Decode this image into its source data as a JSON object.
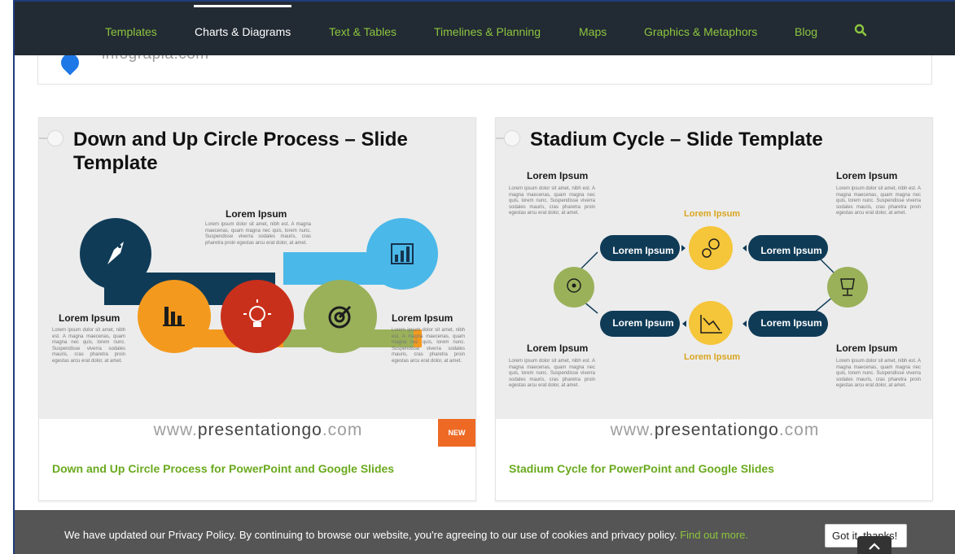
{
  "nav": {
    "items": [
      {
        "label": "Templates"
      },
      {
        "label": "Charts & Diagrams"
      },
      {
        "label": "Text & Tables"
      },
      {
        "label": "Timelines & Planning"
      },
      {
        "label": "Maps"
      },
      {
        "label": "Graphics & Metaphors"
      },
      {
        "label": "Blog"
      }
    ],
    "active": "Charts & Diagrams"
  },
  "logo": {
    "text": "infograpia.com"
  },
  "cards": [
    {
      "slide_title": "Down and Up Circle Process – Slide Template",
      "labels": [
        "Lorem Ipsum",
        "Lorem Ipsum",
        "Lorem Ipsum"
      ],
      "body_text": "Lorem ipsum dolor sit amet, nibh est. A magna maecenas, quam magna nec quis, lorem nunc. Suspendisse viverra sodales mauris, cras pharetra proin egestas arcu erat dolor, at amet.",
      "site": {
        "prefix": "www.",
        "brand": "presentationgo",
        "suffix": ".com"
      },
      "badge": "NEW",
      "link": "Down and Up Circle Process for PowerPoint and Google Slides"
    },
    {
      "slide_title": "Stadium Cycle – Slide Template",
      "labels": [
        "Lorem Ipsum",
        "Lorem Ipsum",
        "Lorem Ipsum",
        "Lorem Ipsum"
      ],
      "gold_labels": [
        "Lorem Ipsum",
        "Lorem Ipsum"
      ],
      "pills": [
        "Lorem Ipsum",
        "Lorem Ipsum",
        "Lorem Ipsum",
        "Lorem Ipsum"
      ],
      "body_text": "Lorem ipsum dolor sit amet, nibh est. A magna maecenas, quam magna nec quis, lorem nunc. Suspendisse viverra sodales mauris, cras pharetra proin egestas arcu erat dolor, at amet.",
      "site": {
        "prefix": "www.",
        "brand": "presentationgo",
        "suffix": ".com"
      },
      "link": "Stadium Cycle for PowerPoint and Google Slides"
    }
  ],
  "cookie": {
    "text": "We have updated our Privacy Policy. By continuing to browse our website, you're agreeing to our use of cookies and privacy policy.",
    "link": "Find out more.",
    "button": "Got it, thanks!"
  },
  "colors": {
    "nav_bg": "#222a33",
    "accent_green": "#8dc63f",
    "link_green": "#6aaa1e",
    "navy": "#0f3b57",
    "orange": "#f39a1e",
    "red": "#c9301c",
    "olive": "#9ab15a",
    "sky": "#4ab8e8",
    "gold": "#f5c53a",
    "badge": "#ee6a24"
  },
  "icons": [
    "search-icon",
    "rocket-icon",
    "chart-icon",
    "bar-chart-icon",
    "lightbulb-icon",
    "target-icon",
    "head-gear-icon",
    "gears-icon",
    "trophy-icon",
    "decline-chart-icon",
    "chevron-up-icon"
  ]
}
